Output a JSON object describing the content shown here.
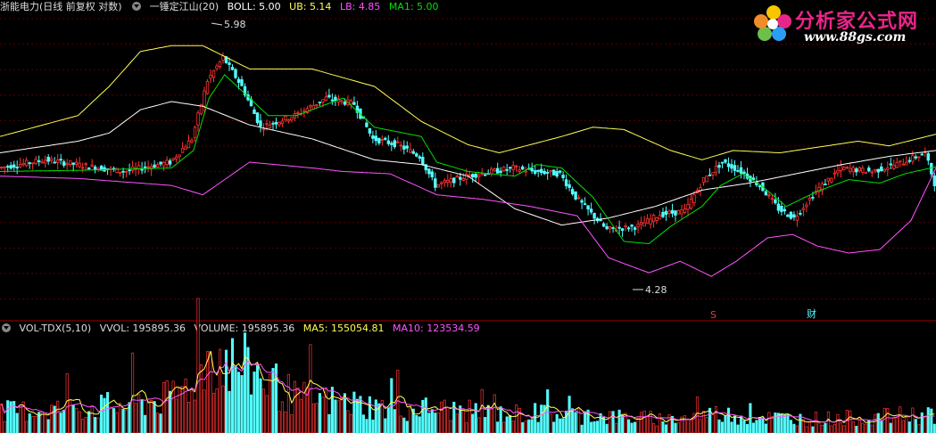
{
  "main_header": {
    "stock": "浙能电力(日线 前复权 对数)",
    "indicator": "一锤定江山(20)",
    "boll": "BOLL: 5.00",
    "ub": "UB: 5.14",
    "lb": "LB: 4.85",
    "ma1": "MA1: 5.00"
  },
  "vol_header": {
    "name": "VOL-TDX(5,10)",
    "vvol": "VVOL: 195895.36",
    "volume": "VOLUME: 195895.36",
    "ma5": "MA5: 155054.81",
    "ma10": "MA10: 123534.59"
  },
  "watermark": {
    "title": "分析家公式网",
    "url": "www.88gs.com"
  },
  "markers": {
    "s_label": "S",
    "cai_label": "财"
  },
  "colors": {
    "up": "#ff3232",
    "down": "#54fcfc",
    "boll": "#ffffff",
    "ub": "#ffff54",
    "lb": "#ff54ff",
    "ma1": "#00e000",
    "grid": "#5a0000",
    "divider": "#a00000",
    "volma5": "#ffff54",
    "volma10": "#ff54ff"
  },
  "chart_data": {
    "type": "candlestick",
    "price_annotations": {
      "high_label": "5.98",
      "low_label": "4.28"
    },
    "series": [
      {
        "name": "BOLL",
        "anchors": [
          [
            0,
            4.98
          ],
          [
            25,
            5.08
          ],
          [
            35,
            5.15
          ],
          [
            45,
            5.35
          ],
          [
            55,
            5.42
          ],
          [
            65,
            5.38
          ],
          [
            80,
            5.22
          ],
          [
            100,
            5.1
          ],
          [
            120,
            4.92
          ],
          [
            135,
            4.88
          ],
          [
            150,
            4.78
          ],
          [
            165,
            4.5
          ],
          [
            180,
            4.36
          ],
          [
            195,
            4.42
          ],
          [
            210,
            4.52
          ],
          [
            225,
            4.66
          ],
          [
            240,
            4.72
          ],
          [
            255,
            4.8
          ],
          [
            270,
            4.88
          ],
          [
            285,
            4.95
          ],
          [
            300,
            5.0
          ]
        ]
      },
      {
        "name": "UB",
        "anchors": [
          [
            0,
            5.12
          ],
          [
            25,
            5.3
          ],
          [
            35,
            5.55
          ],
          [
            45,
            5.85
          ],
          [
            55,
            5.9
          ],
          [
            65,
            5.9
          ],
          [
            80,
            5.7
          ],
          [
            100,
            5.7
          ],
          [
            120,
            5.55
          ],
          [
            135,
            5.25
          ],
          [
            150,
            5.05
          ],
          [
            160,
            4.98
          ],
          [
            170,
            5.05
          ],
          [
            180,
            5.12
          ],
          [
            190,
            5.2
          ],
          [
            200,
            5.18
          ],
          [
            215,
            5.0
          ],
          [
            225,
            4.92
          ],
          [
            235,
            5.0
          ],
          [
            250,
            4.98
          ],
          [
            265,
            5.04
          ],
          [
            275,
            5.08
          ],
          [
            285,
            5.04
          ],
          [
            300,
            5.14
          ]
        ]
      },
      {
        "name": "LB",
        "anchors": [
          [
            0,
            4.78
          ],
          [
            25,
            4.76
          ],
          [
            40,
            4.73
          ],
          [
            55,
            4.7
          ],
          [
            65,
            4.62
          ],
          [
            80,
            4.9
          ],
          [
            100,
            4.85
          ],
          [
            110,
            4.82
          ],
          [
            125,
            4.8
          ],
          [
            140,
            4.62
          ],
          [
            155,
            4.58
          ],
          [
            170,
            4.52
          ],
          [
            185,
            4.44
          ],
          [
            195,
            4.08
          ],
          [
            208,
            3.95
          ],
          [
            218,
            4.05
          ],
          [
            228,
            3.92
          ],
          [
            236,
            4.05
          ],
          [
            246,
            4.25
          ],
          [
            254,
            4.28
          ],
          [
            262,
            4.18
          ],
          [
            272,
            4.12
          ],
          [
            282,
            4.15
          ],
          [
            292,
            4.4
          ],
          [
            300,
            4.85
          ]
        ]
      },
      {
        "name": "MA1",
        "anchors": [
          [
            0,
            4.82
          ],
          [
            25,
            4.83
          ],
          [
            55,
            4.85
          ],
          [
            62,
            5.0
          ],
          [
            67,
            5.45
          ],
          [
            72,
            5.65
          ],
          [
            78,
            5.5
          ],
          [
            86,
            5.3
          ],
          [
            95,
            5.3
          ],
          [
            110,
            5.45
          ],
          [
            120,
            5.2
          ],
          [
            135,
            5.12
          ],
          [
            140,
            4.9
          ],
          [
            150,
            4.82
          ],
          [
            165,
            4.78
          ],
          [
            172,
            4.88
          ],
          [
            180,
            4.85
          ],
          [
            190,
            4.6
          ],
          [
            200,
            4.22
          ],
          [
            208,
            4.2
          ],
          [
            215,
            4.35
          ],
          [
            225,
            4.52
          ],
          [
            231,
            4.7
          ],
          [
            238,
            4.8
          ],
          [
            244,
            4.7
          ],
          [
            252,
            4.52
          ],
          [
            262,
            4.65
          ],
          [
            272,
            4.75
          ],
          [
            282,
            4.72
          ],
          [
            290,
            4.8
          ],
          [
            300,
            4.86
          ]
        ]
      },
      {
        "name": "CLOSE",
        "anchors": [
          [
            0,
            4.85
          ],
          [
            15,
            4.92
          ],
          [
            25,
            4.88
          ],
          [
            40,
            4.82
          ],
          [
            55,
            4.9
          ],
          [
            62,
            5.1
          ],
          [
            67,
            5.6
          ],
          [
            72,
            5.8
          ],
          [
            78,
            5.55
          ],
          [
            84,
            5.2
          ],
          [
            95,
            5.3
          ],
          [
            105,
            5.45
          ],
          [
            114,
            5.4
          ],
          [
            120,
            5.1
          ],
          [
            128,
            5.05
          ],
          [
            135,
            4.95
          ],
          [
            140,
            4.7
          ],
          [
            150,
            4.78
          ],
          [
            165,
            4.85
          ],
          [
            172,
            4.82
          ],
          [
            180,
            4.8
          ],
          [
            185,
            4.6
          ],
          [
            195,
            4.32
          ],
          [
            205,
            4.35
          ],
          [
            212,
            4.45
          ],
          [
            220,
            4.48
          ],
          [
            226,
            4.75
          ],
          [
            232,
            4.9
          ],
          [
            238,
            4.82
          ],
          [
            244,
            4.7
          ],
          [
            250,
            4.5
          ],
          [
            255,
            4.42
          ],
          [
            262,
            4.65
          ],
          [
            270,
            4.85
          ],
          [
            280,
            4.82
          ],
          [
            290,
            4.9
          ],
          [
            297,
            4.98
          ],
          [
            300,
            4.72
          ]
        ]
      },
      {
        "name": "VOLUME",
        "anchors": [
          [
            0,
            0.6
          ],
          [
            20,
            0.7
          ],
          [
            40,
            0.8
          ],
          [
            55,
            1.0
          ],
          [
            62,
            1.5
          ],
          [
            68,
            2.3
          ],
          [
            75,
            2.0
          ],
          [
            82,
            1.8
          ],
          [
            95,
            1.0
          ],
          [
            110,
            0.9
          ],
          [
            125,
            0.7
          ],
          [
            140,
            0.7
          ],
          [
            160,
            0.55
          ],
          [
            175,
            0.55
          ],
          [
            190,
            0.5
          ],
          [
            200,
            0.45
          ],
          [
            215,
            0.4
          ],
          [
            230,
            0.55
          ],
          [
            245,
            0.45
          ],
          [
            260,
            0.4
          ],
          [
            280,
            0.45
          ],
          [
            300,
            0.55
          ]
        ]
      }
    ]
  }
}
